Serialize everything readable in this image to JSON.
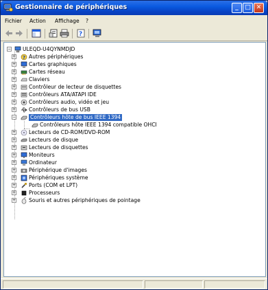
{
  "window": {
    "title": "Gestionnaire de périphériques",
    "title_icon": "device-manager-icon"
  },
  "title_buttons": {
    "minimize": "_",
    "maximize": "□",
    "close": "✕"
  },
  "menu": [
    {
      "label": "Fichier"
    },
    {
      "label": "Action"
    },
    {
      "label": "Affichage"
    },
    {
      "label": "?"
    }
  ],
  "toolbar": {
    "buttons": [
      "back-arrow-icon",
      "forward-arrow-icon",
      "show-hide-console-tree-icon",
      "properties-icon",
      "print-icon",
      "help-icon",
      "scan-hardware-icon"
    ]
  },
  "tree": {
    "root": {
      "label": "ULEQD-U4QYNMDJD",
      "icon": "computer-icon",
      "expanded": true
    },
    "items": [
      {
        "label": "Autres périphériques",
        "icon": "unknown-device-icon",
        "expanded": false
      },
      {
        "label": "Cartes graphiques",
        "icon": "display-adapter-icon",
        "expanded": false
      },
      {
        "label": "Cartes réseau",
        "icon": "network-card-icon",
        "expanded": false
      },
      {
        "label": "Claviers",
        "icon": "keyboard-icon",
        "expanded": false
      },
      {
        "label": "Contrôleur de lecteur de disquettes",
        "icon": "floppy-controller-icon",
        "expanded": false
      },
      {
        "label": "Contrôleurs ATA/ATAPI IDE",
        "icon": "ide-controller-icon",
        "expanded": false
      },
      {
        "label": "Contrôleurs audio, vidéo et jeu",
        "icon": "audio-icon",
        "expanded": false
      },
      {
        "label": "Contrôleurs de bus USB",
        "icon": "usb-icon",
        "expanded": false
      },
      {
        "label": "Contrôleurs hôte de bus IEEE 1394",
        "icon": "ieee1394-icon",
        "expanded": true,
        "selected": true,
        "children": [
          {
            "label": "Contrôleurs hôte IEEE 1394 compatible OHCI",
            "icon": "ieee1394-icon"
          }
        ]
      },
      {
        "label": "Lecteurs de CD-ROM/DVD-ROM",
        "icon": "cdrom-icon",
        "expanded": false
      },
      {
        "label": "Lecteurs de disque",
        "icon": "disk-drive-icon",
        "expanded": false
      },
      {
        "label": "Lecteurs de disquettes",
        "icon": "floppy-drive-icon",
        "expanded": false
      },
      {
        "label": "Moniteurs",
        "icon": "monitor-icon",
        "expanded": false
      },
      {
        "label": "Ordinateur",
        "icon": "computer-icon",
        "expanded": false
      },
      {
        "label": "Périphérique d'images",
        "icon": "imaging-device-icon",
        "expanded": false
      },
      {
        "label": "Périphériques système",
        "icon": "system-devices-icon",
        "expanded": false
      },
      {
        "label": "Ports (COM et LPT)",
        "icon": "port-icon",
        "expanded": false
      },
      {
        "label": "Processeurs",
        "icon": "processor-icon",
        "expanded": false
      },
      {
        "label": "Souris et autres périphériques de pointage",
        "icon": "mouse-icon",
        "expanded": false
      }
    ]
  },
  "colors": {
    "titlebar": "#0a5ae0",
    "selection": "#316ac5",
    "chrome": "#ece9d8"
  }
}
